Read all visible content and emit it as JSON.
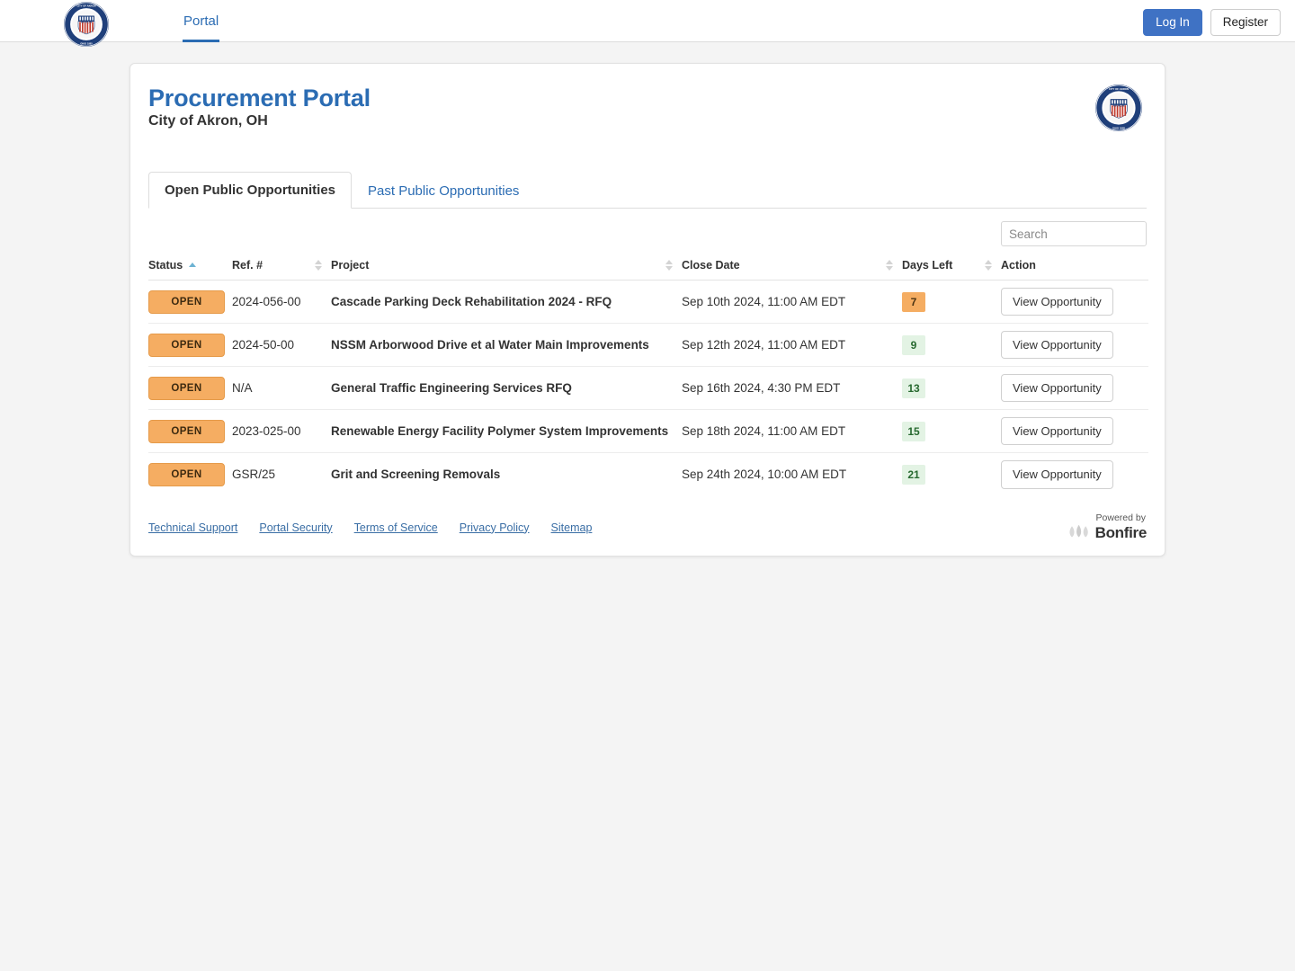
{
  "topbar": {
    "logo_icon": "akron-city-seal-icon",
    "nav": [
      {
        "label": "Portal",
        "active": true
      }
    ],
    "login_label": "Log In",
    "register_label": "Register"
  },
  "card": {
    "title": "Procurement Portal",
    "subtitle": "City of Akron, OH",
    "logo_icon": "akron-city-seal-icon"
  },
  "tabs": [
    {
      "label": "Open Public Opportunities",
      "active": true
    },
    {
      "label": "Past Public Opportunities",
      "active": false
    }
  ],
  "search": {
    "value": "",
    "placeholder": "Search"
  },
  "table": {
    "columns": [
      {
        "label": "Status",
        "sortable": true,
        "sort": "asc"
      },
      {
        "label": "Ref. #",
        "sortable": true,
        "sort": "none"
      },
      {
        "label": "Project",
        "sortable": true,
        "sort": "none"
      },
      {
        "label": "Close Date",
        "sortable": true,
        "sort": "none"
      },
      {
        "label": "Days Left",
        "sortable": true,
        "sort": "none"
      },
      {
        "label": "Action",
        "sortable": false,
        "sort": "none"
      }
    ],
    "action_label": "View Opportunity",
    "rows": [
      {
        "status": "OPEN",
        "ref": "2024-056-00",
        "project": "Cascade Parking Deck Rehabilitation 2024 - RFQ",
        "close_date": "Sep 10th 2024, 11:00 AM EDT",
        "days_left": "7",
        "days_level": "warn"
      },
      {
        "status": "OPEN",
        "ref": "2024-50-00",
        "project": "NSSM Arborwood Drive et al Water Main Improvements",
        "close_date": "Sep 12th 2024, 11:00 AM EDT",
        "days_left": "9",
        "days_level": "ok"
      },
      {
        "status": "OPEN",
        "ref": "N/A",
        "project": "General Traffic Engineering Services RFQ",
        "close_date": "Sep 16th 2024, 4:30 PM EDT",
        "days_left": "13",
        "days_level": "ok"
      },
      {
        "status": "OPEN",
        "ref": "2023-025-00",
        "project": "Renewable Energy Facility Polymer System Improvements",
        "close_date": "Sep 18th 2024, 11:00 AM EDT",
        "days_left": "15",
        "days_level": "ok"
      },
      {
        "status": "OPEN",
        "ref": "GSR/25",
        "project": "Grit and Screening Removals",
        "close_date": "Sep 24th 2024, 10:00 AM EDT",
        "days_left": "21",
        "days_level": "ok"
      }
    ]
  },
  "footer": {
    "links": [
      {
        "label": "Technical Support"
      },
      {
        "label": "Portal Security"
      },
      {
        "label": "Terms of Service"
      },
      {
        "label": "Privacy Policy"
      },
      {
        "label": "Sitemap"
      }
    ],
    "powered_by": "Powered by",
    "brand": "Bonfire",
    "brand_icon": "bonfire-flame-icon"
  },
  "colors": {
    "accent_blue": "#2b6cb3",
    "button_blue": "#3f72c4",
    "badge_orange": "#f5ad62",
    "badge_green_bg": "#e3f3e4",
    "badge_green_text": "#27692f",
    "sort_active": "#6db3d3"
  }
}
